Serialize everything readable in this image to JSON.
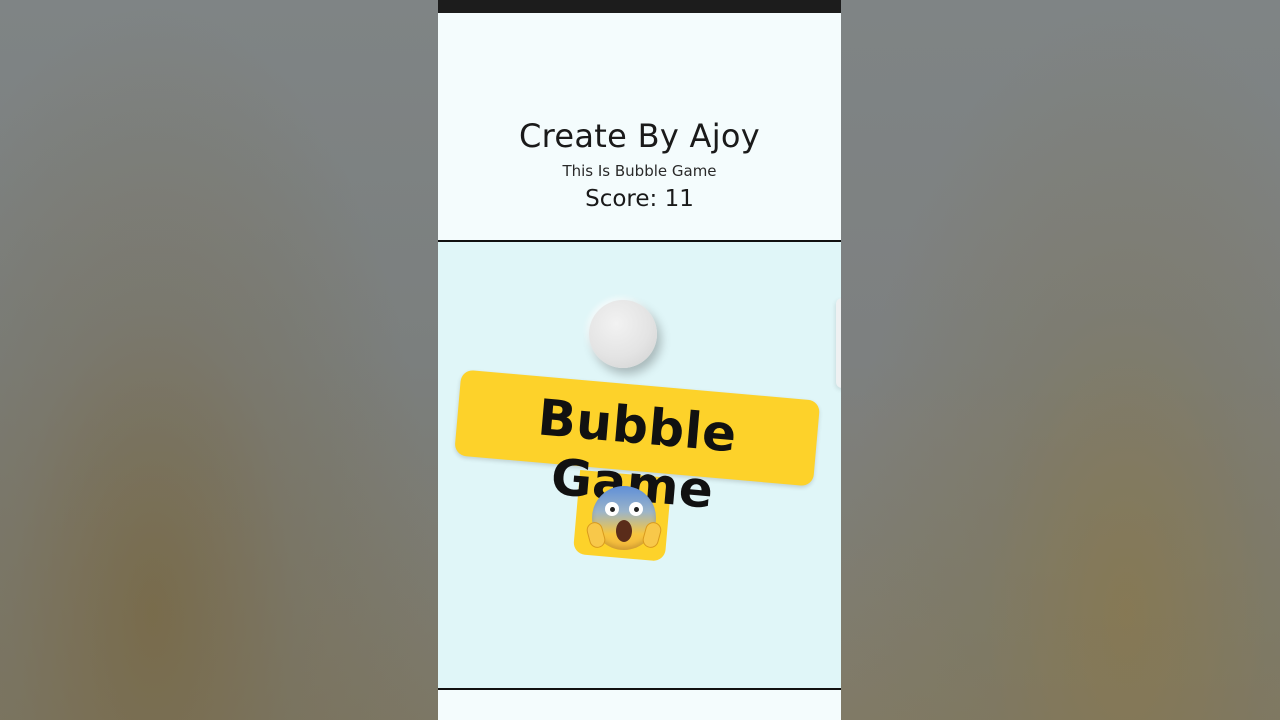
{
  "header": {
    "title": "Create By Ajoy",
    "subtitle": "This Is Bubble Game",
    "score_label": "Score:",
    "score_value": "11"
  },
  "overlay": {
    "sticker_text": "Bubble Game",
    "emoji_name": "face-screaming-in-fear-icon"
  },
  "colors": {
    "sticker_bg": "#fdd22a",
    "game_area_bg": "#e0f6f8",
    "header_bg": "#f4fcfd",
    "bubble": "#e4e4e4"
  }
}
